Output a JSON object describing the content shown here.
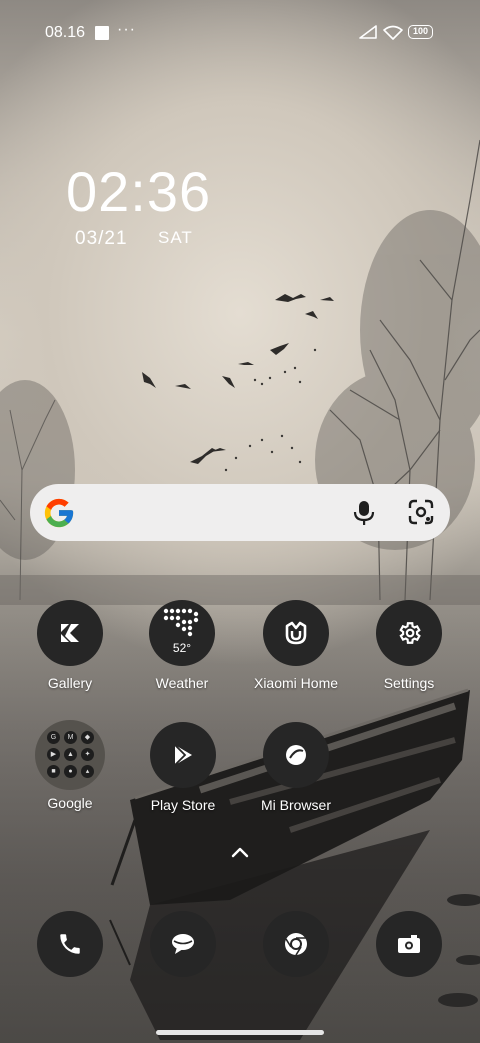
{
  "status_bar": {
    "time": "08.16",
    "more": "···",
    "battery": "100"
  },
  "clock": {
    "time": "02:36",
    "date": "03/21",
    "day": "SAT"
  },
  "search": {
    "logo": "google-g-icon"
  },
  "apps": [
    {
      "label": "Gallery",
      "icon": "gallery-icon"
    },
    {
      "label": "Weather",
      "icon": "weather-icon",
      "temp": "52°"
    },
    {
      "label": "Xiaomi Home",
      "icon": "xiaomi-home-icon"
    },
    {
      "label": "Settings",
      "icon": "gear-icon"
    },
    {
      "label": "Google",
      "icon": "folder-icon"
    },
    {
      "label": "Play Store",
      "icon": "play-store-icon"
    },
    {
      "label": "Mi Browser",
      "icon": "browser-icon"
    }
  ],
  "dock": [
    "phone-icon",
    "messages-icon",
    "chrome-icon",
    "camera-icon"
  ],
  "colors": {
    "icon_bg": "#262626",
    "search_bg": "#efeeee",
    "accent": "#4285F4"
  }
}
